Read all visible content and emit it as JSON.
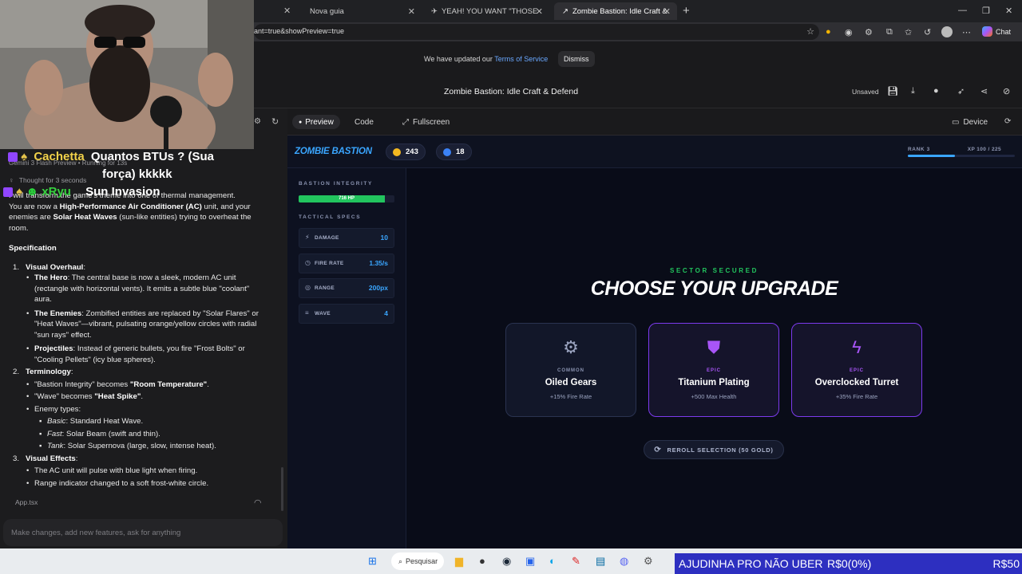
{
  "browser": {
    "tabs": [
      {
        "label": "Nova guia"
      },
      {
        "label": "YEAH! YOU WANT \"THOSE GAMES\""
      },
      {
        "label": "Zombie Bastion: Idle Craft & D | G"
      }
    ],
    "address": "ant=true&showPreview=true",
    "new_tab_icon": "+",
    "chat_label": "Chat"
  },
  "notice": {
    "text": "We have updated our",
    "link": "Terms of Service",
    "dismiss": "Dismiss"
  },
  "app": {
    "title": "Zombie Bastion: Idle Craft & Defend",
    "unsaved": "Unsaved"
  },
  "chat_overlay": {
    "user1": "Cachetta",
    "msg1a": "Quantos BTUs ? (Sua",
    "msg1b": "força) kkkkk",
    "user2": "xRyu",
    "msg2": "Sun Invasion"
  },
  "chat": {
    "model": "Gemini 3 Flash Preview",
    "running": "Running for 13s",
    "thought": "Thought for 3 seconds",
    "intro_a": "I will transform the game's theme into one of thermal management.",
    "intro_b_pre": "You are now a ",
    "intro_b_bold": "High-Performance Air Conditioner (AC)",
    "intro_b_post": " unit, and your",
    "intro_c_pre": "enemies are ",
    "intro_c_bold": "Solar Heat Waves",
    "intro_c_post": " (sun-like entities) trying to overheat the",
    "intro_d": "room.",
    "spec_heading": "Specification",
    "s1_num": "1.",
    "s1_title": "Visual Overhaul",
    "hero_title": "The Hero",
    "hero_l1": ": The central base is now a sleek, modern AC unit",
    "hero_l2": "(rectangle with horizontal vents). It emits a subtle blue \"coolant\"",
    "hero_l3": "aura.",
    "enemies_title": "The Enemies",
    "enemies_l1": ": Zombified entities are replaced by \"Solar Flares\" or",
    "enemies_l2": "\"Heat Waves\"—vibrant, pulsating orange/yellow circles with radial",
    "enemies_l3": "\"sun rays\" effect.",
    "proj_title": "Projectiles",
    "proj_l1": ": Instead of generic bullets, you fire \"Frost Bolts\" or",
    "proj_l2": "\"Cooling Pellets\" (icy blue spheres).",
    "s2_num": "2.",
    "s2_title": "Terminology",
    "t1_pre": "\"Bastion Integrity\" becomes ",
    "t1_bold": "\"Room Temperature\"",
    "t2_pre": "\"Wave\" becomes ",
    "t2_bold": "\"Heat Spike\"",
    "t3": "Enemy types:",
    "e1_i": "Basic",
    "e1": ": Standard Heat Wave.",
    "e2_i": "Fast",
    "e2": ": Solar Beam (swift and thin).",
    "e3_i": "Tank",
    "e3": ": Solar Supernova (large, slow, intense heat).",
    "s3_num": "3.",
    "s3_title": "Visual Effects",
    "v1": "The AC unit will pulse with blue light when firing.",
    "v2": "Range indicator changed to a soft frost-white circle.",
    "file": "App.tsx",
    "placeholder": "Make changes, add new features, ask for anything"
  },
  "preview_bar": {
    "preview": "Preview",
    "code": "Code",
    "fullscreen": "Fullscreen",
    "device": "Device"
  },
  "game": {
    "title": "ZOMBIE BASTION",
    "gold": "243",
    "gems": "18",
    "rank": "RANK 3",
    "xp": "XP 100 / 225",
    "xp_fraction": 0.44,
    "integrity_label": "BASTION INTEGRITY",
    "hp_text": "716 HP",
    "hp_fraction": 0.9,
    "specs_label": "TACTICAL SPECS",
    "specs": [
      {
        "label": "DAMAGE",
        "value": "10",
        "icon": "bolt-icon"
      },
      {
        "label": "FIRE RATE",
        "value": "1.35/s",
        "icon": "clock-icon"
      },
      {
        "label": "RANGE",
        "value": "200px",
        "icon": "target-icon"
      },
      {
        "label": "WAVE",
        "value": "4",
        "icon": "layers-icon"
      }
    ],
    "secured": "SECTOR SECURED",
    "choose": "CHOOSE YOUR UPGRADE",
    "cards": [
      {
        "rarity": "COMMON",
        "name": "Oiled Gears",
        "desc": "+15% Fire Rate",
        "icon": "gear-icon"
      },
      {
        "rarity": "EPIC",
        "name": "Titanium Plating",
        "desc": "+500 Max Health",
        "icon": "shield-icon"
      },
      {
        "rarity": "EPIC",
        "name": "Overclocked Turret",
        "desc": "+35% Fire Rate",
        "icon": "lightning-icon"
      }
    ],
    "reroll": "REROLL SELECTION (50 GOLD)"
  },
  "taskbar": {
    "search": "Pesquisar",
    "ticker_left": "AJUDINHA PRO NÃO UBER",
    "ticker_mid": "R$0(0%)",
    "ticker_right": "R$50"
  }
}
